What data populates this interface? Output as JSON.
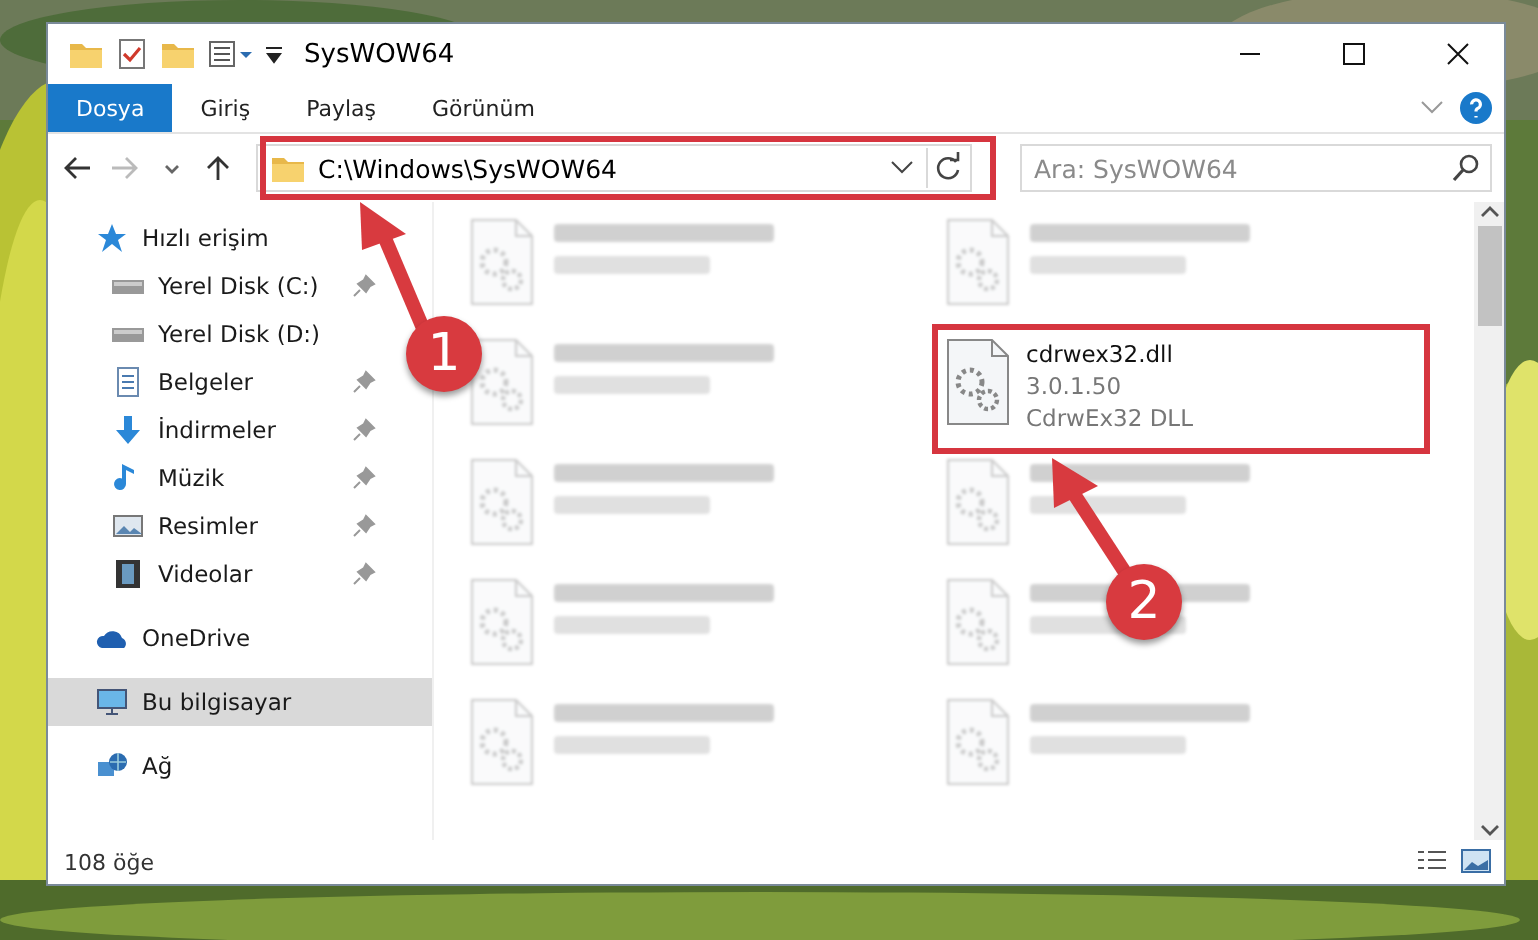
{
  "window": {
    "title": "SysWOW64"
  },
  "ribbon_tabs": [
    {
      "label": "Dosya",
      "selected": true
    },
    {
      "label": "Giriş",
      "selected": false
    },
    {
      "label": "Paylaş",
      "selected": false
    },
    {
      "label": "Görünüm",
      "selected": false
    }
  ],
  "address_bar": {
    "path": "C:\\Windows\\SysWOW64"
  },
  "search": {
    "placeholder": "Ara: SysWOW64"
  },
  "sidebar": {
    "items": [
      {
        "label": "Hızlı erişim",
        "kind": "star",
        "selected": false,
        "children": [
          {
            "label": "Yerel Disk (C:)",
            "kind": "drive",
            "pinned": true,
            "selected": false
          },
          {
            "label": "Yerel Disk (D:)",
            "kind": "drive",
            "pinned": false,
            "selected": false
          },
          {
            "label": "Belgeler",
            "kind": "document",
            "pinned": true,
            "selected": false
          },
          {
            "label": "İndirmeler",
            "kind": "download",
            "pinned": true,
            "selected": false
          },
          {
            "label": "Müzik",
            "kind": "music",
            "pinned": true,
            "selected": false
          },
          {
            "label": "Resimler",
            "pinned": true,
            "selected": false
          },
          {
            "label": "Videolar",
            "kind": "video",
            "pinned": true,
            "selected": false
          }
        ]
      },
      {
        "label": "OneDrive",
        "kind": "cloud",
        "selected": false
      },
      {
        "label": "Bu bilgisayar",
        "kind": "computer",
        "selected": true
      },
      {
        "label": "Ağ",
        "kind": "network",
        "selected": false
      }
    ]
  },
  "files": [
    {
      "kind": "blurred"
    },
    {
      "kind": "blurred"
    },
    {
      "kind": "blurred"
    },
    {
      "kind": "file",
      "name": "cdrwex32.dll",
      "details": [
        "3.0.1.50",
        "CdrwEx32 DLL"
      ]
    },
    {
      "kind": "blurred"
    },
    {
      "kind": "blurred"
    },
    {
      "kind": "blurred"
    },
    {
      "kind": "blurred"
    },
    {
      "kind": "blurred"
    },
    {
      "kind": "blurred"
    }
  ],
  "status_bar": {
    "item_count": "108 öğe"
  },
  "annotations": [
    {
      "number": "1"
    },
    {
      "number": "2"
    }
  ]
}
